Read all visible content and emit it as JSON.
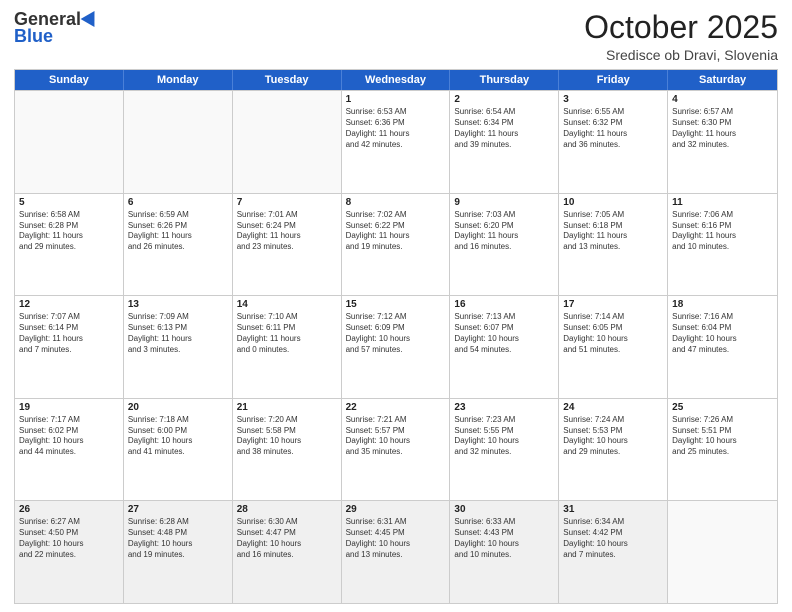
{
  "logo": {
    "general": "General",
    "blue": "Blue"
  },
  "header": {
    "month": "October 2025",
    "location": "Sredisce ob Dravi, Slovenia"
  },
  "days": [
    "Sunday",
    "Monday",
    "Tuesday",
    "Wednesday",
    "Thursday",
    "Friday",
    "Saturday"
  ],
  "rows": [
    [
      {
        "day": "",
        "text": "",
        "empty": true
      },
      {
        "day": "",
        "text": "",
        "empty": true
      },
      {
        "day": "",
        "text": "",
        "empty": true
      },
      {
        "day": "1",
        "text": "Sunrise: 6:53 AM\nSunset: 6:36 PM\nDaylight: 11 hours\nand 42 minutes."
      },
      {
        "day": "2",
        "text": "Sunrise: 6:54 AM\nSunset: 6:34 PM\nDaylight: 11 hours\nand 39 minutes."
      },
      {
        "day": "3",
        "text": "Sunrise: 6:55 AM\nSunset: 6:32 PM\nDaylight: 11 hours\nand 36 minutes."
      },
      {
        "day": "4",
        "text": "Sunrise: 6:57 AM\nSunset: 6:30 PM\nDaylight: 11 hours\nand 32 minutes."
      }
    ],
    [
      {
        "day": "5",
        "text": "Sunrise: 6:58 AM\nSunset: 6:28 PM\nDaylight: 11 hours\nand 29 minutes."
      },
      {
        "day": "6",
        "text": "Sunrise: 6:59 AM\nSunset: 6:26 PM\nDaylight: 11 hours\nand 26 minutes."
      },
      {
        "day": "7",
        "text": "Sunrise: 7:01 AM\nSunset: 6:24 PM\nDaylight: 11 hours\nand 23 minutes."
      },
      {
        "day": "8",
        "text": "Sunrise: 7:02 AM\nSunset: 6:22 PM\nDaylight: 11 hours\nand 19 minutes."
      },
      {
        "day": "9",
        "text": "Sunrise: 7:03 AM\nSunset: 6:20 PM\nDaylight: 11 hours\nand 16 minutes."
      },
      {
        "day": "10",
        "text": "Sunrise: 7:05 AM\nSunset: 6:18 PM\nDaylight: 11 hours\nand 13 minutes."
      },
      {
        "day": "11",
        "text": "Sunrise: 7:06 AM\nSunset: 6:16 PM\nDaylight: 11 hours\nand 10 minutes."
      }
    ],
    [
      {
        "day": "12",
        "text": "Sunrise: 7:07 AM\nSunset: 6:14 PM\nDaylight: 11 hours\nand 7 minutes."
      },
      {
        "day": "13",
        "text": "Sunrise: 7:09 AM\nSunset: 6:13 PM\nDaylight: 11 hours\nand 3 minutes."
      },
      {
        "day": "14",
        "text": "Sunrise: 7:10 AM\nSunset: 6:11 PM\nDaylight: 11 hours\nand 0 minutes."
      },
      {
        "day": "15",
        "text": "Sunrise: 7:12 AM\nSunset: 6:09 PM\nDaylight: 10 hours\nand 57 minutes."
      },
      {
        "day": "16",
        "text": "Sunrise: 7:13 AM\nSunset: 6:07 PM\nDaylight: 10 hours\nand 54 minutes."
      },
      {
        "day": "17",
        "text": "Sunrise: 7:14 AM\nSunset: 6:05 PM\nDaylight: 10 hours\nand 51 minutes."
      },
      {
        "day": "18",
        "text": "Sunrise: 7:16 AM\nSunset: 6:04 PM\nDaylight: 10 hours\nand 47 minutes."
      }
    ],
    [
      {
        "day": "19",
        "text": "Sunrise: 7:17 AM\nSunset: 6:02 PM\nDaylight: 10 hours\nand 44 minutes."
      },
      {
        "day": "20",
        "text": "Sunrise: 7:18 AM\nSunset: 6:00 PM\nDaylight: 10 hours\nand 41 minutes."
      },
      {
        "day": "21",
        "text": "Sunrise: 7:20 AM\nSunset: 5:58 PM\nDaylight: 10 hours\nand 38 minutes."
      },
      {
        "day": "22",
        "text": "Sunrise: 7:21 AM\nSunset: 5:57 PM\nDaylight: 10 hours\nand 35 minutes."
      },
      {
        "day": "23",
        "text": "Sunrise: 7:23 AM\nSunset: 5:55 PM\nDaylight: 10 hours\nand 32 minutes."
      },
      {
        "day": "24",
        "text": "Sunrise: 7:24 AM\nSunset: 5:53 PM\nDaylight: 10 hours\nand 29 minutes."
      },
      {
        "day": "25",
        "text": "Sunrise: 7:26 AM\nSunset: 5:51 PM\nDaylight: 10 hours\nand 25 minutes."
      }
    ],
    [
      {
        "day": "26",
        "text": "Sunrise: 6:27 AM\nSunset: 4:50 PM\nDaylight: 10 hours\nand 22 minutes."
      },
      {
        "day": "27",
        "text": "Sunrise: 6:28 AM\nSunset: 4:48 PM\nDaylight: 10 hours\nand 19 minutes."
      },
      {
        "day": "28",
        "text": "Sunrise: 6:30 AM\nSunset: 4:47 PM\nDaylight: 10 hours\nand 16 minutes."
      },
      {
        "day": "29",
        "text": "Sunrise: 6:31 AM\nSunset: 4:45 PM\nDaylight: 10 hours\nand 13 minutes."
      },
      {
        "day": "30",
        "text": "Sunrise: 6:33 AM\nSunset: 4:43 PM\nDaylight: 10 hours\nand 10 minutes."
      },
      {
        "day": "31",
        "text": "Sunrise: 6:34 AM\nSunset: 4:42 PM\nDaylight: 10 hours\nand 7 minutes."
      },
      {
        "day": "",
        "text": "",
        "empty": true
      }
    ]
  ]
}
